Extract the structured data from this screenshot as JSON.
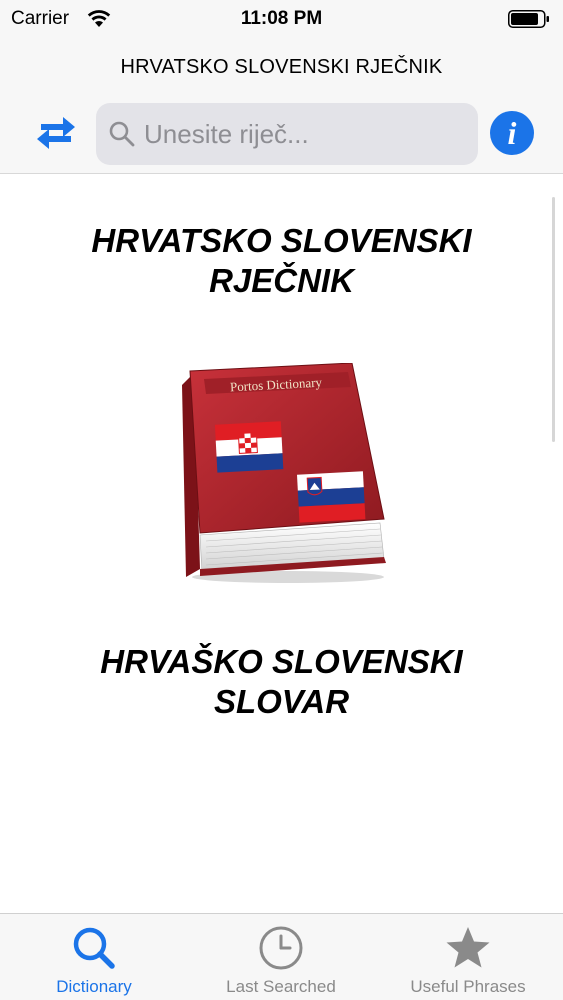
{
  "status_bar": {
    "carrier": "Carrier",
    "time": "11:08 PM",
    "wifi_icon": "wifi-icon",
    "battery_icon": "battery-icon"
  },
  "header": {
    "title": "HRVATSKO SLOVENSKI RJEČNIK",
    "swap_icon": "swap-arrows-icon",
    "info_icon": "info-icon",
    "info_label": "i"
  },
  "search": {
    "placeholder": "Unesite riječ...",
    "value": ""
  },
  "main": {
    "heading_top_line1": "HRVATSKO SLOVENSKI",
    "heading_top_line2": "RJEČNIK",
    "book_title": "Portos Dictionary",
    "heading_bottom_line1": "HRVAŠKO SLOVENSKI",
    "heading_bottom_line2": "SLOVAR"
  },
  "tabs": [
    {
      "label": "Dictionary",
      "icon": "search-icon",
      "active": true
    },
    {
      "label": "Last Searched",
      "icon": "clock-icon",
      "active": false
    },
    {
      "label": "Useful Phrases",
      "icon": "star-icon",
      "active": false
    }
  ],
  "colors": {
    "accent": "#1b74e8",
    "inactive": "#8a8a8a",
    "book_red": "#b3242c"
  }
}
